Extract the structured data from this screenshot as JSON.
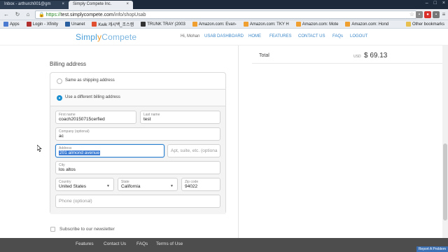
{
  "browser": {
    "tabs": [
      {
        "label": "Inbox - arthurch001@gm"
      },
      {
        "label": "Simply Compete Inc."
      }
    ],
    "url_scheme": "https://",
    "url_host": "test.simplycompete.com",
    "url_path": "/info/shopUsab",
    "bookmarks": [
      {
        "label": "Apps"
      },
      {
        "label": "Login - Xfinity"
      },
      {
        "label": "Unanet"
      },
      {
        "label": "Kwik 캐시백_조스캠"
      },
      {
        "label": "TRUNK TRAY (2003"
      },
      {
        "label": "Amazon.com: Evan-"
      },
      {
        "label": "Amazon.com: TKY H"
      },
      {
        "label": "Amazon.com: Mote"
      },
      {
        "label": "Amazon.com: Hond"
      }
    ],
    "other_bookmarks": "Other bookmarks"
  },
  "header": {
    "logo_a": "Simpl",
    "logo_b": "y",
    "logo_c": "Compete",
    "greeting": "Hi, Mohan",
    "nav": [
      {
        "label": "USAB DASHBOARD"
      },
      {
        "label": "HOME"
      },
      {
        "label": "FEATURES"
      },
      {
        "label": "CONTACT US"
      },
      {
        "label": "FAQs"
      },
      {
        "label": "LOGOUT"
      }
    ]
  },
  "billing": {
    "title": "Billing address",
    "option_same": "Same as shipping address",
    "option_different": "Use a different billing address",
    "first_name": {
      "label": "First name",
      "value": "coach20150715cerfied"
    },
    "last_name": {
      "label": "Last name",
      "value": "test"
    },
    "company": {
      "label": "Company (optional)",
      "value": "ac"
    },
    "address": {
      "label": "Address",
      "value": "201 almond avenue"
    },
    "apt": {
      "placeholder": "Apt, suite, etc. (optiona"
    },
    "city": {
      "label": "City",
      "value": "los altos"
    },
    "country": {
      "label": "Country",
      "value": "United States"
    },
    "state": {
      "label": "State",
      "value": "California"
    },
    "zip": {
      "label": "Zip code",
      "value": "94022"
    },
    "phone": {
      "placeholder": "Phone (optional)"
    },
    "newsletter": "Subscribe to our newsletter"
  },
  "summary": {
    "total_label": "Total",
    "currency": "USD",
    "amount": "$ 69.13"
  },
  "footer": {
    "links": [
      {
        "label": "Features"
      },
      {
        "label": "Contact Us"
      },
      {
        "label": "FAQs"
      },
      {
        "label": "Terms of Use"
      }
    ],
    "report": "Report A Problem"
  },
  "colors": {
    "accent": "#1b8fd0",
    "logo_blue": "#4a9fd8",
    "logo_orange": "#f19a2b",
    "footer_bg": "#4d4d4d"
  }
}
